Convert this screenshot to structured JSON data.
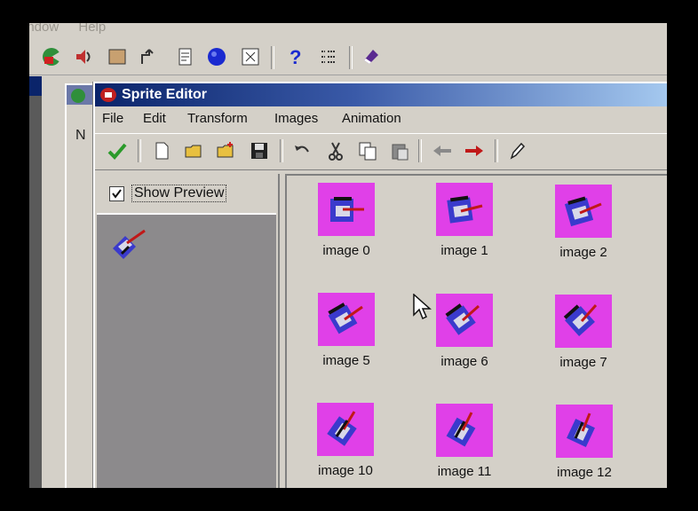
{
  "host_menu": {
    "items": [
      "indow",
      "Help"
    ]
  },
  "window": {
    "title": "Sprite Editor"
  },
  "menu": {
    "items": [
      "File",
      "Edit",
      "Transform",
      "Images",
      "Animation"
    ]
  },
  "background_window": {
    "label": "N"
  },
  "preview": {
    "checkbox_label": "Show Preview",
    "checked": true
  },
  "thumbnail_color": "#e040e8",
  "images": [
    {
      "label": "image 0"
    },
    {
      "label": "image 1"
    },
    {
      "label": "image 2"
    },
    {
      "label": "image 5"
    },
    {
      "label": "image 6"
    },
    {
      "label": "image 7"
    },
    {
      "label": "image 10"
    },
    {
      "label": "image 11"
    },
    {
      "label": "image 12"
    }
  ]
}
